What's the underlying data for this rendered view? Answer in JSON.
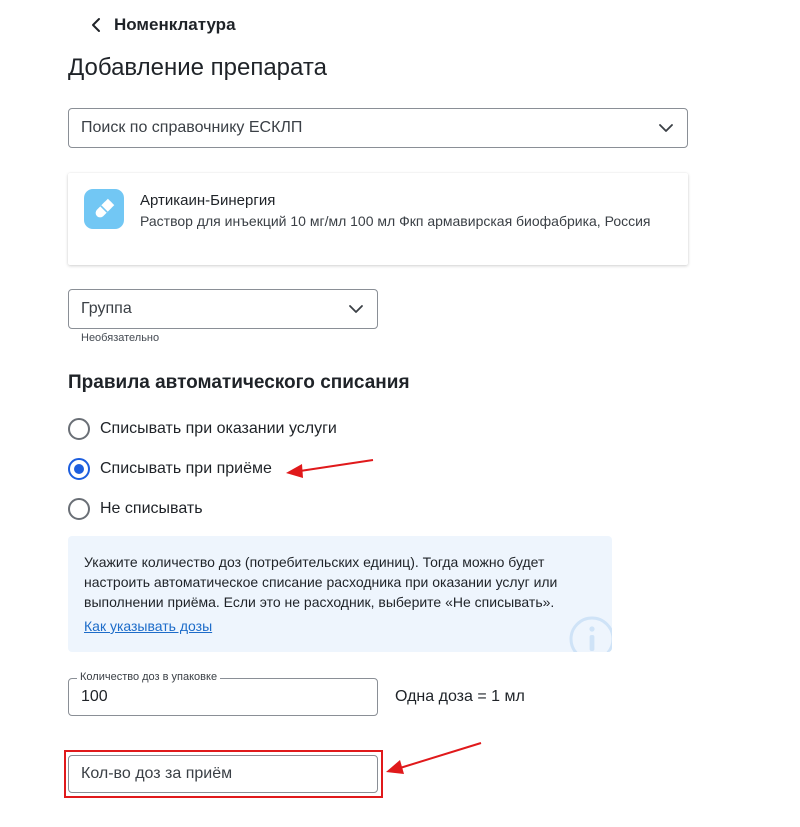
{
  "header": {
    "back_label": "Номенклатура"
  },
  "page": {
    "title": "Добавление препарата"
  },
  "search": {
    "placeholder": "Поиск по справочнику ЕСКЛП"
  },
  "drug": {
    "name": "Артикаин-Бинергия",
    "description": "Раствор для инъекций 10 мг/мл 100 мл Фкп армавирская биофабрика, Россия"
  },
  "group": {
    "placeholder": "Группа",
    "helper": "Необязательно"
  },
  "write_off": {
    "title": "Правила автоматического списания",
    "options": [
      {
        "label": "Списывать при оказании услуги",
        "checked": false
      },
      {
        "label": "Списывать при приёме",
        "checked": true
      },
      {
        "label": "Не списывать",
        "checked": false
      }
    ]
  },
  "info": {
    "text": "Укажите количество доз (потребительских единиц). Тогда можно будет настроить автоматическое списание расходника при оказании услуг или выполнении приёма. Если это не расходник, выберите «Не списывать».",
    "link": "Как указывать дозы"
  },
  "doses": {
    "label": "Количество доз в упаковке",
    "value": "100",
    "note": "Одна доза = 1 мл",
    "per_visit_placeholder": "Кол-во доз за приём"
  },
  "colors": {
    "accent": "#1d5ede",
    "link": "#1d6cc9",
    "annotation": "#e0191b",
    "info_bg": "#eef5fd",
    "drug_icon_bg": "#72c7f4"
  },
  "icons": {
    "back": "chevron-left-icon",
    "dropdown": "chevron-down-icon",
    "drug": "pill-icon",
    "info": "info-icon"
  }
}
